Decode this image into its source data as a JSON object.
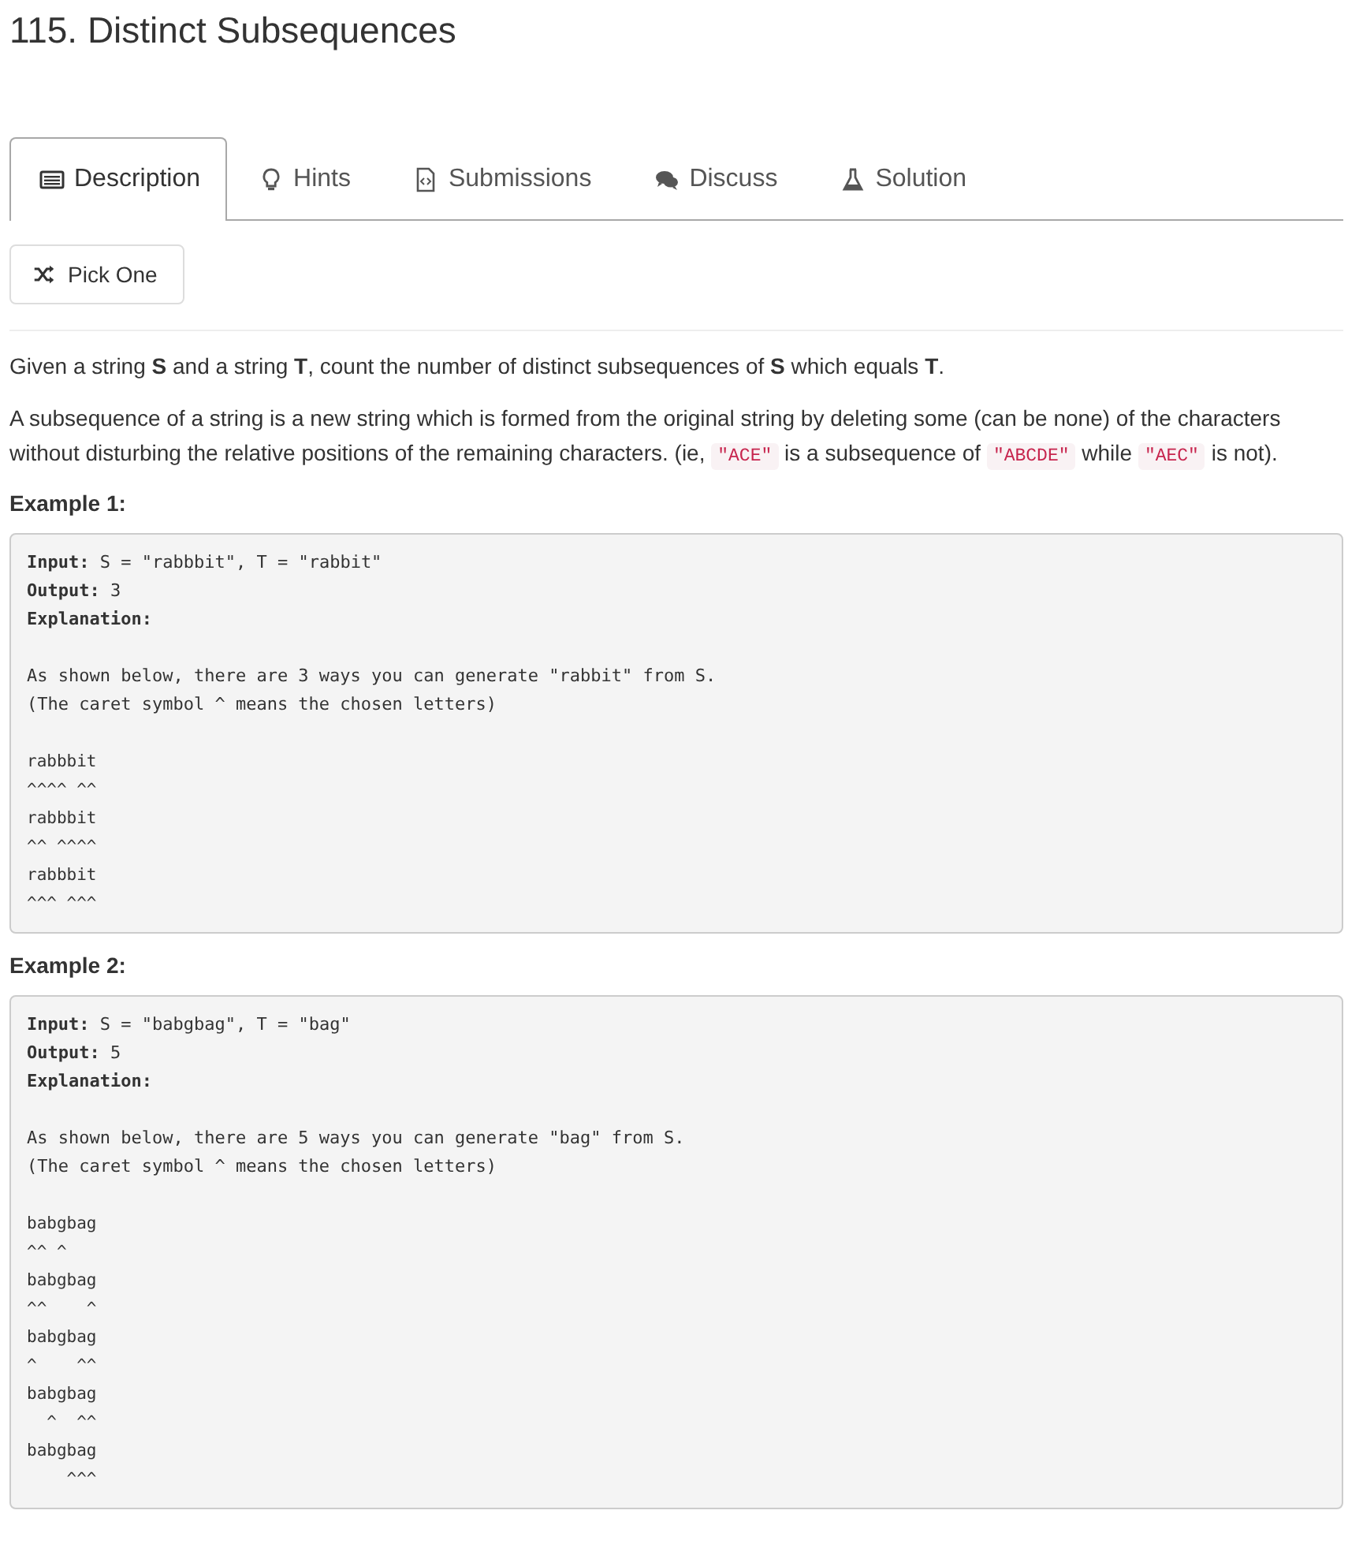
{
  "title": "115. Distinct Subsequences",
  "tabs": [
    {
      "label": "Description",
      "kind": "description",
      "selected": true
    },
    {
      "label": "Hints",
      "kind": "hints",
      "selected": false
    },
    {
      "label": "Submissions",
      "kind": "submissions",
      "selected": false
    },
    {
      "label": "Discuss",
      "kind": "discuss",
      "selected": false
    },
    {
      "label": "Solution",
      "kind": "solution",
      "selected": false
    }
  ],
  "pick_button": {
    "label": "Pick One"
  },
  "statement": "Given a string **S** and a string **T**, count the number of distinct subsequences of **S** which equals **T**.",
  "paragraph": [
    {
      "kind": "text",
      "text": "A subsequence of a string is a new string which is formed from the original string by deleting some (can be none) of the characters without disturbing the relative positions of the remaining characters. (ie, "
    },
    {
      "kind": "code",
      "text": "\"ACE\""
    },
    {
      "kind": "text",
      "text": " is a subsequence of "
    },
    {
      "kind": "code",
      "text": "\"ABCDE\""
    },
    {
      "kind": "text",
      "text": " while "
    },
    {
      "kind": "code",
      "text": "\"AEC\""
    },
    {
      "kind": "text",
      "text": " is not)."
    }
  ],
  "examples": [
    {
      "title": "Example 1:",
      "input_label": "Input:",
      "input": "S = \"rabbbit\", T = \"rabbit\"",
      "output_label": "Output:",
      "output": "3",
      "explanation_label": "Explanation:",
      "notes": [
        "As shown below, there are 3 ways you can generate \"rabbit\" from S.",
        "(The caret symbol ^ means the chosen letters)"
      ],
      "diagram": [
        "rabbbit",
        "^^^^ ^^",
        "rabbbit",
        "^^ ^^^^",
        "rabbbit",
        "^^^ ^^^"
      ]
    },
    {
      "title": "Example 2:",
      "input_label": "Input:",
      "input": "S = \"babgbag\", T = \"bag\"",
      "output_label": "Output:",
      "output": "5",
      "explanation_label": "Explanation:",
      "notes": [
        "As shown below, there are 5 ways you can generate \"bag\" from S.",
        "(The caret symbol ^ means the chosen letters)"
      ],
      "diagram": [
        "babgbag",
        "^^ ^",
        "babgbag",
        "^^    ^",
        "babgbag",
        "^    ^^",
        "babgbag",
        "  ^  ^^",
        "babgbag",
        "    ^^^"
      ]
    }
  ]
}
